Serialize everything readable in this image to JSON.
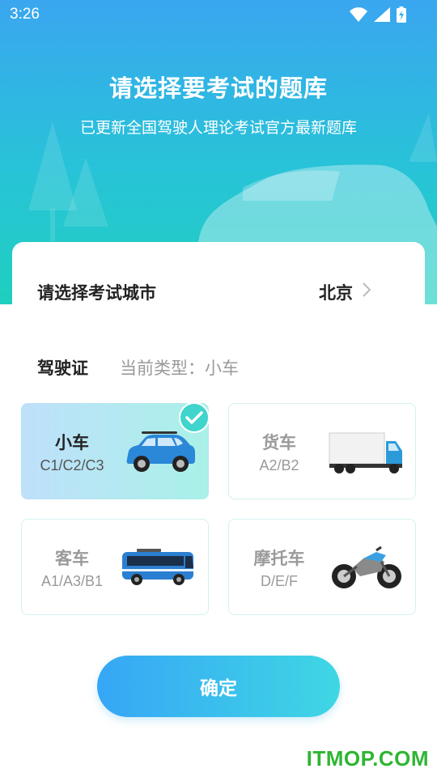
{
  "status_bar": {
    "time": "3:26",
    "icons": [
      "wifi-icon",
      "cellular-signal-icon",
      "battery-charging-icon"
    ]
  },
  "header": {
    "title": "请选择要考试的题库",
    "subtitle": "已更新全国驾驶人理论考试官方最新题库"
  },
  "city": {
    "label": "请选择考试城市",
    "value": "北京"
  },
  "license": {
    "label": "驾驶证",
    "current_type": "当前类型：小车"
  },
  "vehicle_types": [
    {
      "name": "小车",
      "codes": "C1/C2/C3",
      "icon": "car-icon",
      "selected": true
    },
    {
      "name": "货车",
      "codes": "A2/B2",
      "icon": "truck-icon",
      "selected": false
    },
    {
      "name": "客车",
      "codes": "A1/A3/B1",
      "icon": "bus-icon",
      "selected": false
    },
    {
      "name": "摩托车",
      "codes": "D/E/F",
      "icon": "motorcycle-icon",
      "selected": false
    }
  ],
  "confirm_button": "确定",
  "watermark": "ITMOP.COM",
  "colors": {
    "header_gradient_top": "#3aa6f0",
    "header_gradient_bottom": "#1fcfbf",
    "check_badge": "#3fd5cd",
    "button_gradient_start": "#36a6f6",
    "button_gradient_end": "#3fd7e4",
    "watermark": "#2fb533"
  }
}
